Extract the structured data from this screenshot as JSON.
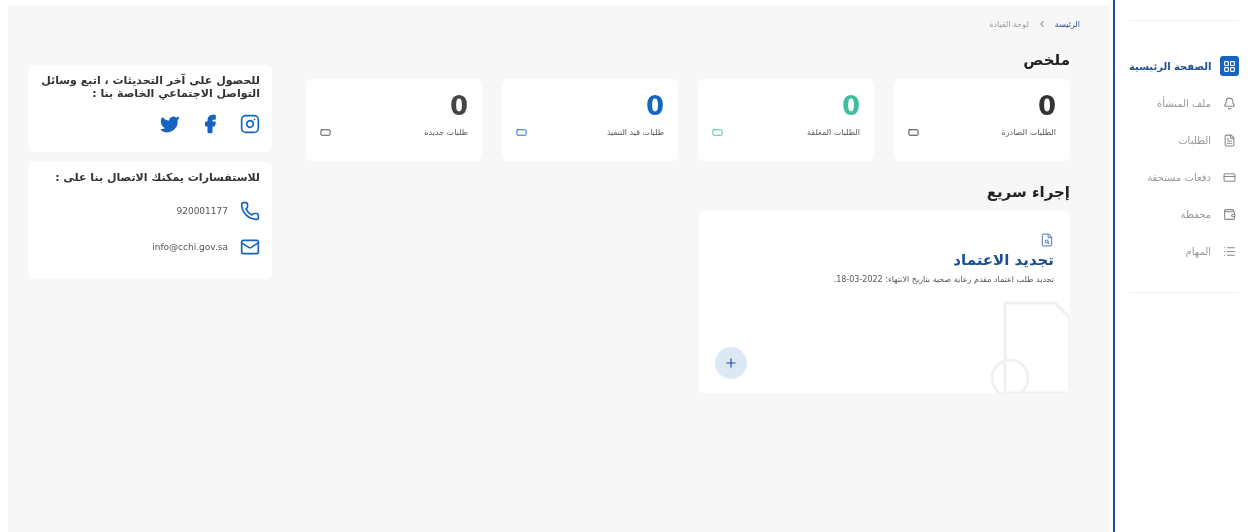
{
  "sidebar": {
    "items": [
      {
        "label": "الصفحة الرئيسية",
        "selected": true
      },
      {
        "label": "ملف المنشأة",
        "selected": false
      },
      {
        "label": "الطلبات",
        "selected": false
      },
      {
        "label": "دفعات مستحقة",
        "selected": false
      },
      {
        "label": "محفظة",
        "selected": false
      },
      {
        "label": "المهام",
        "selected": false
      }
    ]
  },
  "breadcrumb": [
    {
      "label": "الرئيسة",
      "selected": false
    },
    {
      "label": "لوحة القيادة",
      "selected": true
    }
  ],
  "summary": {
    "title": "ملخص",
    "cards": [
      {
        "count": "0",
        "label": "الطلبات الصادرة",
        "color": "#333333"
      },
      {
        "count": "0",
        "label": "الطلبات المغلقة",
        "color": "#3dbf9f"
      },
      {
        "count": "0",
        "label": "طلبات قيد التنفيذ",
        "color": "#1565c0"
      },
      {
        "count": "0",
        "label": "طلبات جديدة",
        "color": "#444444"
      }
    ]
  },
  "quick_actions": {
    "title": "إجراء سريع",
    "cards": [
      {
        "title": "تجديد الاعتماد",
        "description": "تجديد طلب اعتماد مقدم رعاية صحية بتاريخ الانتهاء: 2022-03-18."
      }
    ]
  },
  "social": {
    "text": "للحصول على آخر التحديثات ، اتبع وسائل التواصل الاجتماعي الخاصة بنا :"
  },
  "contact": {
    "title": "للاستفسارات يمكنك الاتصال بنا على :",
    "phone": "920001177",
    "email": "info@cchi.gov.sa"
  }
}
